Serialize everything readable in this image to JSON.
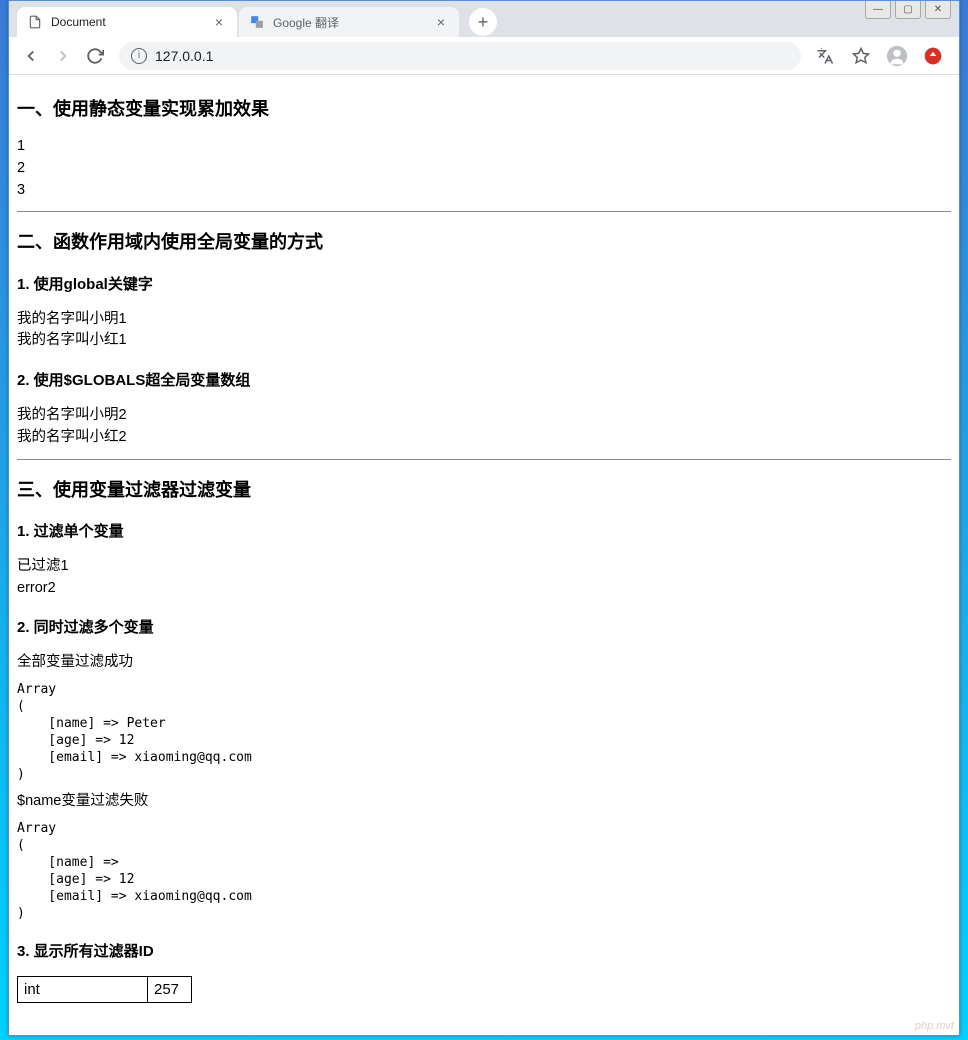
{
  "browser": {
    "tabs": [
      {
        "title": "Document",
        "active": true
      },
      {
        "title": "Google 翻译",
        "active": false
      }
    ],
    "url": "127.0.0.1"
  },
  "document": {
    "section1": {
      "heading": "一、使用静态变量实现累加效果",
      "lines": [
        "1",
        "2",
        "3"
      ]
    },
    "section2": {
      "heading": "二、函数作用域内使用全局变量的方式",
      "sub1": {
        "heading": "1. 使用global关键字",
        "lines": [
          "我的名字叫小明1",
          "我的名字叫小红1"
        ]
      },
      "sub2": {
        "heading": "2. 使用$GLOBALS超全局变量数组",
        "lines": [
          "我的名字叫小明2",
          "我的名字叫小红2"
        ]
      }
    },
    "section3": {
      "heading": "三、使用变量过滤器过滤变量",
      "sub1": {
        "heading": "1. 过滤单个变量",
        "lines": [
          "已过滤1",
          "error2"
        ]
      },
      "sub2": {
        "heading": "2. 同时过滤多个变量",
        "success_msg": "全部变量过滤成功",
        "array1": "Array\n(\n    [name] => Peter\n    [age] => 12\n    [email] => xiaoming@qq.com\n)",
        "fail_msg": "$name变量过滤失败",
        "array2": "Array\n(\n    [name] => \n    [age] => 12\n    [email] => xiaoming@qq.com\n)"
      },
      "sub3": {
        "heading": "3. 显示所有过滤器ID",
        "table": {
          "row1_label": "int",
          "row1_value": "257"
        }
      }
    }
  },
  "watermark": "php.mvt"
}
